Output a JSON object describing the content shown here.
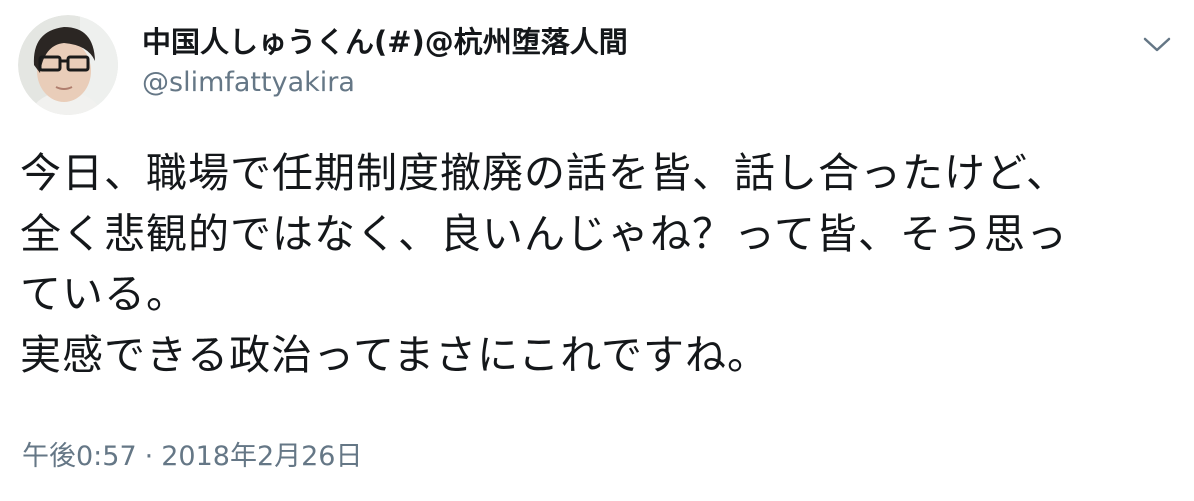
{
  "user": {
    "display_name": "中国人しゅうくん(#)@杭州堕落人間",
    "handle": "@slimfattyakira",
    "avatar_icon": "user-avatar-photo"
  },
  "menu": {
    "icon": "chevron-down-icon"
  },
  "tweet": {
    "text": "今日、職場で任期制度撤廃の話を皆、話し合ったけど、\n全く悲観的ではなく、良いんじゃね？って皆、そう思っ\nている。\n実感できる政治ってまさにこれですね。"
  },
  "meta": {
    "time": "午後0:57",
    "separator": "·",
    "date": "2018年2月26日"
  },
  "colors": {
    "text": "#14171a",
    "secondary": "#657786"
  }
}
